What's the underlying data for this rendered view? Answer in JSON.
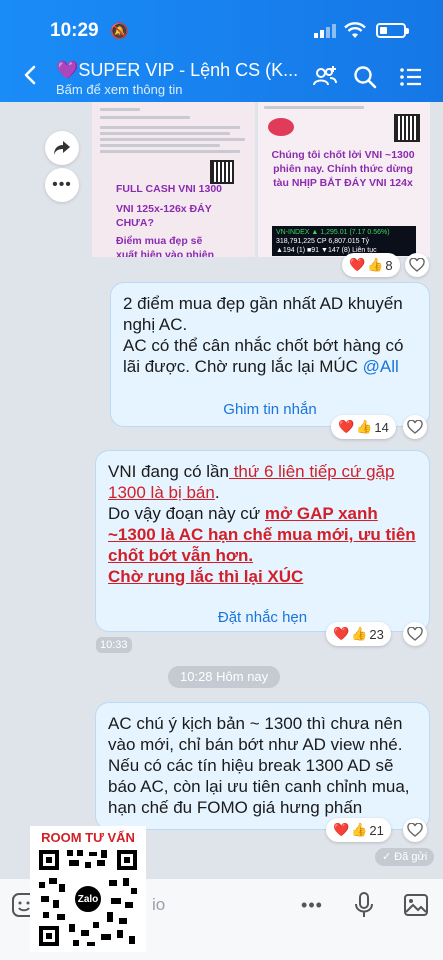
{
  "status": {
    "time": "10:29"
  },
  "header": {
    "title": "💜SUPER VIP - Lệnh CS (K...",
    "subtitle": "Bấm để xem thông tin"
  },
  "photos": {
    "left": {
      "lines": [
        "FULL CASH VNI 1300",
        "VNI 125x-126x ĐÁY CHƯA?",
        "Điểm mua đẹp sẽ xuất hiện vào phiên mai?"
      ]
    },
    "right": {
      "main_text": "Chúng tôi chốt lời VNI ~1300 phiên nay. Chính thức dừng tàu NHỊP BẮT ĐÁY VNI 124x",
      "ticker_line1": "VN-INDEX ▲ 1,295.01 (7.17 0.56%)",
      "ticker_line2": "318,791,225 CP 6,807.015 Tỷ",
      "ticker_line3": "▲194 (1) ■91 ▼147 (8) Liên tục"
    },
    "reaction_count": "8"
  },
  "messages": [
    {
      "text_parts": [
        "2 điểm mua đẹp gần nhất AD khuyến nghị AC.",
        "AC có thể cân nhắc chốt bớt hàng có lãi được. Chờ rung lắc lại MÚC "
      ],
      "mention": "@All",
      "action": "Ghim tin nhắn",
      "reaction_count": "14"
    },
    {
      "p1_plain": "VNI đang có lần",
      "p1_red": " thứ 6 liên tiếp cứ gặp 1300 là bị bán",
      "p1_end": ".",
      "p2_plain": "Do vậy đoạn này cứ ",
      "p2_red": "mở GAP xanh ~1300 là AC hạn chế mua mới, ưu tiên chốt bớt vẫn hơn.",
      "p3_red": "Chờ rung lắc thì lại XÚC",
      "action": "Đặt nhắc hẹn",
      "time": "10:33",
      "reaction_count": "23"
    },
    {
      "text": "AC chú ý kịch bản ~ 1300 thì chưa nên vào mới, chỉ bán bớt như AD view nhé. Nếu có các tín hiệu break 1300 AD sẽ báo AC, còn lại ưu tiên canh chỉnh mua, hạn chế đu FOMO giá hưng phấn",
      "reaction_count": "21",
      "status": "✓ Đã gửi"
    }
  ],
  "date_separator": "10:28 Hôm nay",
  "composer": {
    "placeholder_fragment": "io"
  },
  "qr_card": {
    "title": "ROOM TƯ VẤN",
    "logo": "Zalo"
  },
  "colors": {
    "header": "#1a8cf7",
    "bubble": "#e6f4ff",
    "accent_red": "#d0202a",
    "link": "#1b74d9"
  }
}
